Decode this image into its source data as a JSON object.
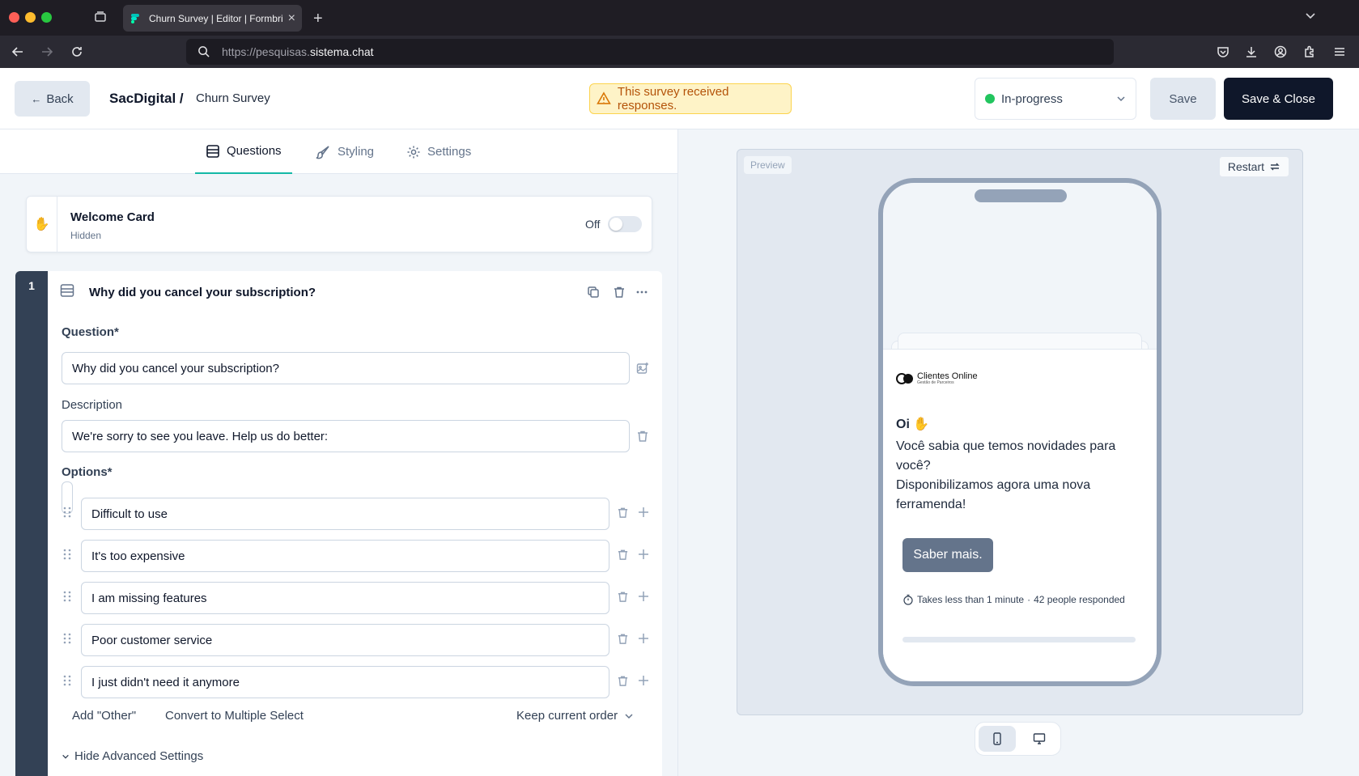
{
  "browser": {
    "tab_title": "Churn Survey | Editor | Formbricks",
    "url_prefix": "https://pesquisas.",
    "url_host": "sistema.chat"
  },
  "header": {
    "back_label": "Back",
    "org_name": "SacDigital /",
    "survey_name": "Churn Survey",
    "alert_text": "This survey received responses.",
    "status_value": "In-progress",
    "save_label": "Save",
    "save_close_label": "Save & Close"
  },
  "editor_tabs": [
    {
      "label": "Questions",
      "icon": "list-icon"
    },
    {
      "label": "Styling",
      "icon": "paintbrush-icon"
    },
    {
      "label": "Settings",
      "icon": "gear-icon"
    }
  ],
  "welcome_card": {
    "icon": "✋",
    "title": "Welcome Card",
    "subtitle": "Hidden",
    "toggle_label": "Off"
  },
  "question": {
    "number": "1",
    "title": "Why did you cancel your subscription?",
    "question_label": "Question*",
    "question_value": "Why did you cancel your subscription?",
    "description_label": "Description",
    "description_value": "We're sorry to see you leave. Help us do better:",
    "options_label": "Options*",
    "options": [
      "Difficult to use",
      "It's too expensive",
      "I am missing features",
      "Poor customer service",
      "I just didn't need it anymore"
    ],
    "add_other": "Add \"Other\"",
    "convert": "Convert to Multiple Select",
    "order": "Keep current order",
    "advanced": "Hide Advanced Settings"
  },
  "preview": {
    "tag": "Preview",
    "restart": "Restart",
    "logo_main": "Clientes Online",
    "logo_sub": "Gestão de Parceiros",
    "heading": "Oi ✋",
    "body_lines": [
      "Você sabia que temos novidades para",
      "você?",
      "Disponibilizamos agora uma nova",
      "ferramenda!"
    ],
    "cta": "Saber mais.",
    "meta_time": "Takes less than 1 minute",
    "meta_sep": "·",
    "meta_count": "42 people responded"
  },
  "colors": {
    "accent": "#14b8a6",
    "primary_dark": "#0f172a",
    "status_green": "#22c55e",
    "warning_bg": "#fef3c7",
    "warning_text": "#b45309"
  }
}
